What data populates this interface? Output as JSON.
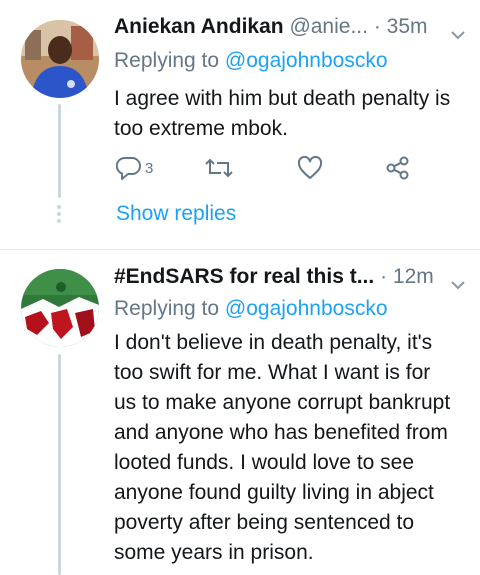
{
  "tweets": [
    {
      "name": "Aniekan Andikan",
      "handle": "@anie...",
      "time": "· 35m",
      "replying_prefix": "Replying to ",
      "replying_to": "@ogajohnboscko",
      "lines": [
        "I agree with him but death penalty is",
        "too extreme mbok."
      ],
      "reply_count": "3",
      "show_replies": "Show replies"
    },
    {
      "name": "#EndSARS for real this t...",
      "time": "· 12m",
      "replying_prefix": "Replying to ",
      "replying_to": "@ogajohnboscko",
      "lines": [
        "I don't believe in death penalty, it's",
        "too swift for me. What I want is for",
        "us to make anyone corrupt bankrupt",
        "and anyone who has benefited from",
        "looted funds. I would love to see",
        "anyone found guilty living in abject",
        "poverty after being sentenced to",
        "some years in prison."
      ]
    }
  ],
  "icons": [
    "reply-icon",
    "retweet-icon",
    "like-icon",
    "share-icon",
    "chevron-down-icon"
  ],
  "colors": {
    "accent": "#1da1f2",
    "secondary_text": "#657786",
    "thread_line": "#ccd6dd"
  }
}
